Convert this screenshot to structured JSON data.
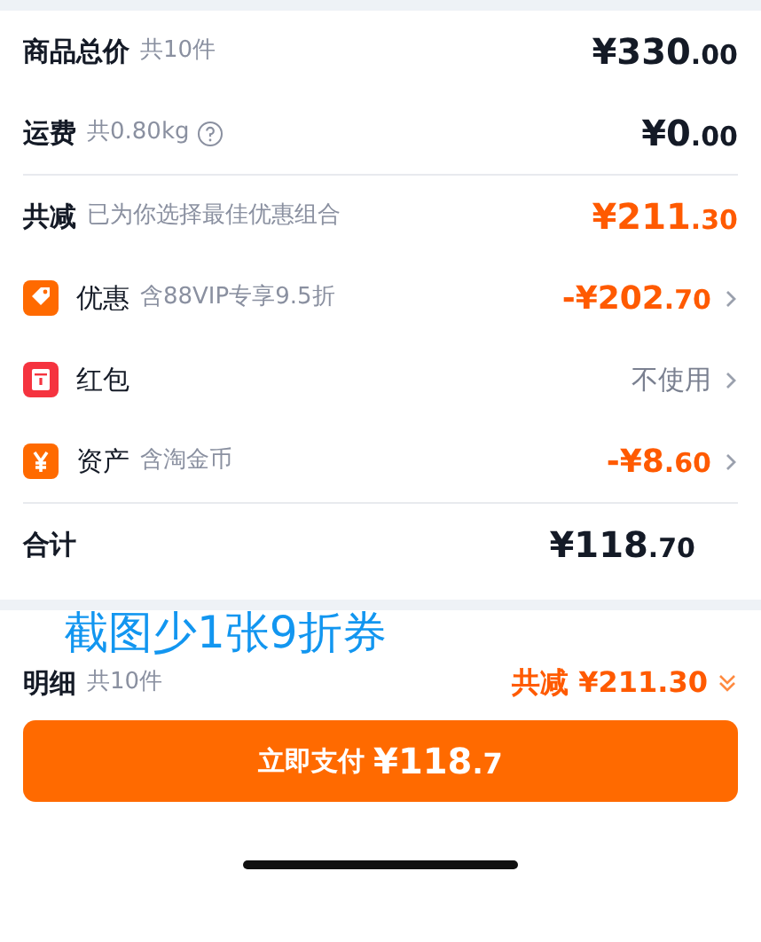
{
  "summary": [
    {
      "label": "商品总价",
      "note": "共10件",
      "help": false,
      "price_main": "¥330",
      "price_cents": ".00"
    },
    {
      "label": "运费",
      "note": "共0.80kg",
      "help": true,
      "price_main": "¥0",
      "price_cents": ".00"
    }
  ],
  "discount": {
    "label": "共减",
    "note": "已为你选择最佳优惠组合",
    "price_main": "¥211",
    "price_cents": ".30",
    "items": [
      {
        "kind": "coupon",
        "label": "优惠",
        "note": "含88VIP专享9.5折",
        "price_main": "-¥202",
        "price_cents": ".70",
        "color": "#ff6a00"
      },
      {
        "kind": "packet",
        "label": "红包",
        "value": "不使用",
        "color": "#f5333f"
      },
      {
        "kind": "asset",
        "label": "资产",
        "note": "含淘金币",
        "price_main": "-¥8",
        "price_cents": ".60",
        "color": "#ff6a00"
      }
    ]
  },
  "total": {
    "label": "合计",
    "price_main": "¥118",
    "price_cents": ".70"
  },
  "annotation": "截图少1张9折券",
  "detail": {
    "label": "明细",
    "note": "共10件",
    "saving": "共减 ¥211.30",
    "expanded": false
  },
  "pay_button": {
    "label": "立即支付",
    "price_main": "¥118",
    "price_cents": ".7"
  }
}
